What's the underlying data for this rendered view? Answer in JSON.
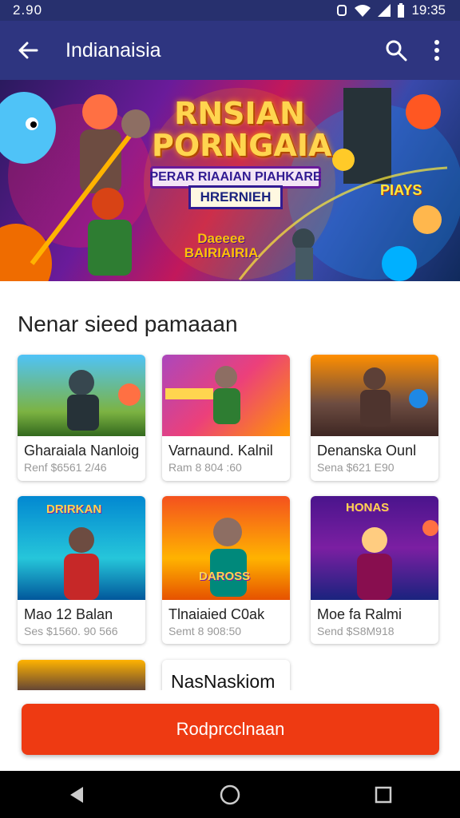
{
  "status_bar": {
    "time_left": "2.90",
    "time_right": "19:35"
  },
  "app_bar": {
    "title": "Indianaisia"
  },
  "hero": {
    "title": "RNSIAN PORNGAIA",
    "subtitle": "PERAR RIAAIAN PIAHKARE",
    "subtitle2": "HRERNIEH",
    "badge": "Daeeee BAIRIAIRIA",
    "badge2": "PIAYS"
  },
  "section": {
    "title": "Nenar sieed pamaaan"
  },
  "games": [
    {
      "name": "Gharaiala Nanloig",
      "sub": "Renf $6561 2/46"
    },
    {
      "name": "Varnaund. Kalnil",
      "sub": "Ram 8 804 :60"
    },
    {
      "name": "Denanska Ounl",
      "sub": "Sena $621 E90"
    },
    {
      "name": "Mao 12 Balan",
      "sub": "Ses $1560. 90 566",
      "caption": "DRIRKAN"
    },
    {
      "name": "Tlnaiaied C0ak",
      "sub": "Semt 8 908:50",
      "caption": "DAROSS"
    },
    {
      "name": "Moe fa Ralmi",
      "sub": "Send $S8M918",
      "caption": "HONAS"
    }
  ],
  "partial_text": "NasNaskiom",
  "cta": {
    "label": "Rodprcclnaan"
  },
  "colors": {
    "app_bar": "#2e3580",
    "cta": "#ee3a12"
  }
}
